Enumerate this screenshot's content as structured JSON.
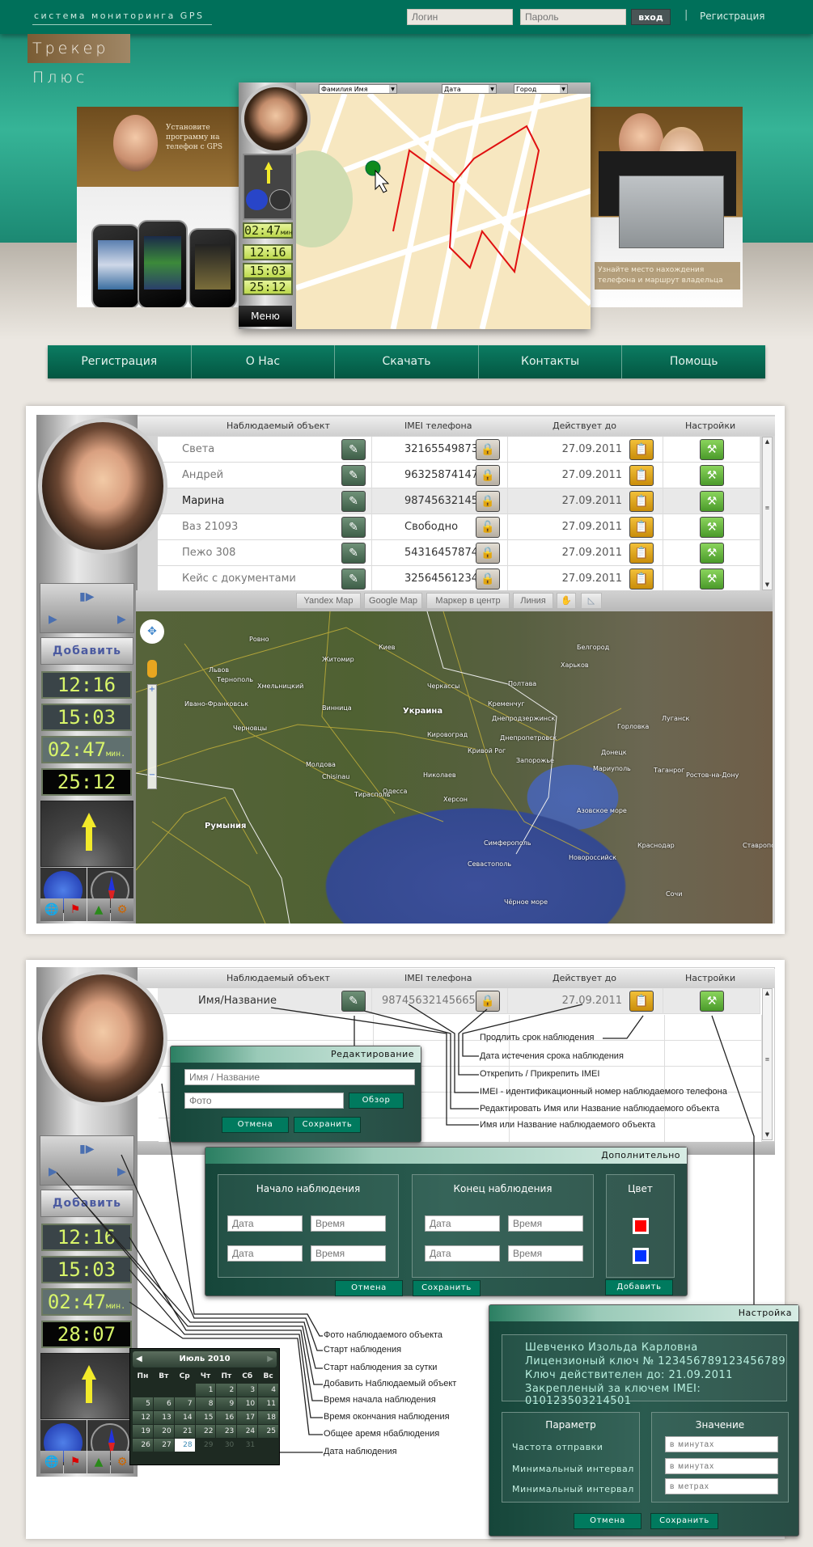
{
  "header": {
    "tagline": "система мониторинга GPS",
    "brand": "Трекер Плюс",
    "login_placeholder": "Логин",
    "password_placeholder": "Пароль",
    "login_button": "вход",
    "separator": "|",
    "register_link": "Регистрация",
    "color_header": "#00705a"
  },
  "hero": {
    "left_ad_text": "Установите программу на телефон с GPS",
    "right_ad_text": "Узнайте место нахождения телефона и маршрут владельца",
    "device": {
      "select_name": "Фамилия Имя",
      "select_date": "Дата",
      "select_city": "Город",
      "display_1": "02:47",
      "display_1_unit": "мин",
      "display_2": "12:16",
      "display_3": "15:03",
      "display_4": "25:12",
      "menu_button": "Меню"
    }
  },
  "nav": {
    "items": [
      "Регистрация",
      "О Нас",
      "Скачать",
      "Контакты",
      "Помощь"
    ]
  },
  "table_headers": {
    "object": "Наблюдаемый объект",
    "imei": "IMEI телефона",
    "valid_until": "Действует до",
    "settings": "Настройки"
  },
  "section1": {
    "panel": {
      "add_button": "Добавить",
      "display_1": "12:16",
      "display_2": "15:03",
      "display_3": "02:47",
      "display_3_unit": "мин.",
      "display_4": "25:12"
    },
    "rows": [
      {
        "name": "Света",
        "imei": "321655498732",
        "locked": true,
        "date": "27.09.2011"
      },
      {
        "name": "Андрей",
        "imei": "963258741478",
        "locked": true,
        "date": "27.09.2011"
      },
      {
        "name": "Марина",
        "imei": "987456321456",
        "locked": true,
        "date": "27.09.2011",
        "selected": true
      },
      {
        "name": "Ваз 21093",
        "imei": "Свободно",
        "locked": false,
        "date": "27.09.2011"
      },
      {
        "name": "Пежо 308",
        "imei": "543164578749",
        "locked": true,
        "date": "27.09.2011"
      },
      {
        "name": "Кейс с документами",
        "imei": "325645612345",
        "locked": true,
        "date": "27.09.2011"
      }
    ],
    "map_toolbar": {
      "yandex": "Yandex Map",
      "google": "Google Map",
      "center_marker": "Маркер в центр",
      "line": "Линия",
      "hand_icon": "hand-icon",
      "polygon_icon": "polygon-icon"
    },
    "map_labels": [
      "Киев",
      "Житомир",
      "Ровно",
      "Львов",
      "Тернополь",
      "Хмельницкий",
      "Винница",
      "Ивано-Франковськ",
      "Черновцы",
      "Украина",
      "Черкассы",
      "Полтава",
      "Харьков",
      "Белгород",
      "Кременчуг",
      "Днепродзержинск",
      "Днепропетровск",
      "Кировоград",
      "Кривой Рог",
      "Запорожье",
      "Донецк",
      "Луганск",
      "Горловка",
      "Мариуполь",
      "Таганрог",
      "Ростов-на-Дону",
      "Николаев",
      "Одесса",
      "Херсон",
      "Молдова",
      "Chisinau",
      "Тирасполь",
      "Румыния",
      "Азовское море",
      "Симферополь",
      "Севастополь",
      "Чёрное море",
      "Краснодар",
      "Новороссийск",
      "Ставрополь",
      "Волгоград",
      "Сочи",
      "Пятигорск"
    ]
  },
  "section2": {
    "panel": {
      "add_button": "Добавить",
      "display_1": "12:16",
      "display_2": "15:03",
      "display_3": "02:47",
      "display_3_unit": "мин.",
      "display_4": "28:07"
    },
    "row": {
      "name": "Имя/Название",
      "imei": "987456321456654",
      "date": "27.09.2011"
    },
    "edit_popup": {
      "title": "Редактирование",
      "name_placeholder": "Имя / Название",
      "photo_placeholder": "Фото",
      "browse_button": "Обзор",
      "cancel_button": "Отмена",
      "save_button": "Сохранить"
    },
    "extra_popup": {
      "title": "Дополнительно",
      "start_title": "Начало наблюдения",
      "end_title": "Конец наблюдения",
      "color_title": "Цвет",
      "date_placeholder": "Дата",
      "time_placeholder": "Время",
      "color_1": "#ff0000",
      "color_2": "#0033ff",
      "cancel_button": "Отмена",
      "save_button": "Сохранить",
      "add_button": "Добавить"
    },
    "settings_popup": {
      "title": "Настройка",
      "owner": "Шевченко Изольда Карловна",
      "license": "Лицензионый ключ № 123456789123456789",
      "valid": "Ключ действителен до: 21.09.2011",
      "imei": "Закрепленый за ключем IMEI: 010123503214501",
      "param_title": "Параметр",
      "value_title": "Значение",
      "params": [
        "Частота отправки",
        "Минимальный интервал",
        "Минимальный интервал"
      ],
      "placeholders": [
        "в минутах",
        "в минутах",
        "в метрах"
      ],
      "cancel_button": "Отмена",
      "save_button": "Сохранить"
    },
    "calendar": {
      "title": "Июль 2010",
      "weekdays": [
        "Пн",
        "Вт",
        "Ср",
        "Чт",
        "Пт",
        "Сб",
        "Вс"
      ],
      "first_weekday_index": 3,
      "days_in_month": 31,
      "selected_day": 28
    },
    "annotations_top": [
      "Продлить срок наблюдения",
      "Дата истечения срока наблюдения",
      "Открепить / Прикрепить IMEI",
      "IMEI  - идентификационный номер наблюдаемого телефона",
      "Редактировать Имя или Название наблюдаемого объекта",
      "Имя или Название наблюдаемого объекта"
    ],
    "annotations_left": [
      "Фото наблюдаемого объекта",
      "Старт наблюдения",
      "Старт наблюдения за сутки",
      "Добавить Наблюдаемый объект",
      "Время начала наблюдения",
      "Время окончания наблюдения",
      "Общее аремя нбаблюдения",
      "Дата наблюдения"
    ]
  }
}
